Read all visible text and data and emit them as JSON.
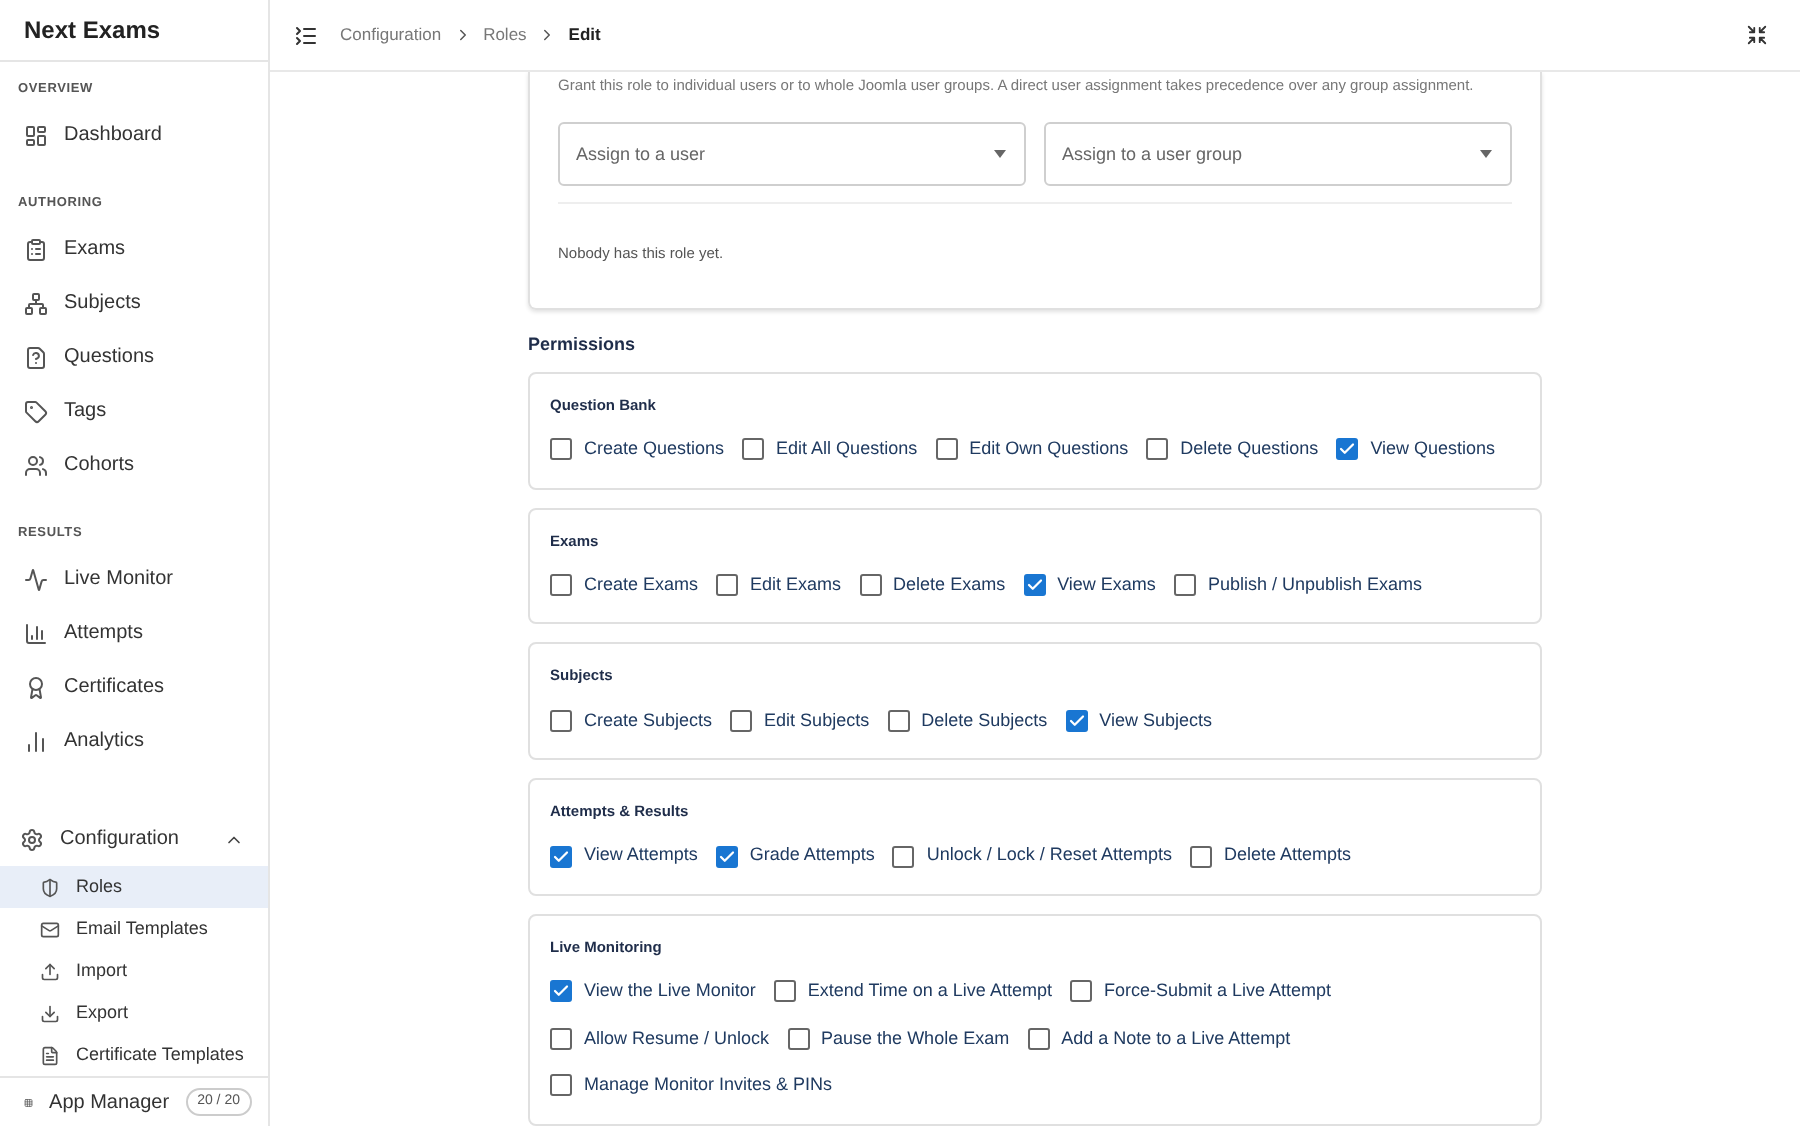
{
  "sidebar": {
    "title": "Next Exams",
    "sections": [
      {
        "heading": "OVERVIEW",
        "items": [
          {
            "label": "Dashboard",
            "selected": false
          }
        ]
      },
      {
        "heading": "AUTHORING",
        "items": [
          {
            "label": "Exams",
            "selected": false
          },
          {
            "label": "Subjects",
            "selected": false
          },
          {
            "label": "Questions",
            "selected": false
          },
          {
            "label": "Tags",
            "selected": false
          },
          {
            "label": "Cohorts",
            "selected": false
          }
        ]
      },
      {
        "heading": "RESULTS",
        "items": [
          {
            "label": "Live Monitor",
            "selected": false
          },
          {
            "label": "Attempts",
            "selected": false
          },
          {
            "label": "Certificates",
            "selected": false
          },
          {
            "label": "Analytics",
            "selected": false
          }
        ]
      },
      {
        "items": [
          {
            "label": "Configuration",
            "selected": false,
            "expanded": true,
            "children": [
              {
                "label": "Roles",
                "selected": true
              },
              {
                "label": "Email Templates",
                "selected": false
              },
              {
                "label": "Import",
                "selected": false
              },
              {
                "label": "Export",
                "selected": false
              },
              {
                "label": "Certificate Templates",
                "selected": false
              }
            ]
          }
        ]
      }
    ],
    "footer": {
      "label": "App Manager",
      "badge": "20 / 20"
    }
  },
  "breadcrumb": [
    "Configuration",
    "Roles",
    "Edit"
  ],
  "assignment": {
    "description": "Grant this role to individual users or to whole Joomla user groups. A direct user assignment takes precedence over any group assignment.",
    "fields": [
      {
        "placeholder": "Assign to a user"
      },
      {
        "placeholder": "Assign to a user group"
      }
    ],
    "empty_message": "Nobody has this role yet."
  },
  "permissions": {
    "heading": "Permissions",
    "groups": [
      {
        "title": "Question Bank",
        "items": [
          {
            "label": "Create Questions",
            "checked": false
          },
          {
            "label": "Edit All Questions",
            "checked": false
          },
          {
            "label": "Edit Own Questions",
            "checked": false
          },
          {
            "label": "Delete Questions",
            "checked": false
          },
          {
            "label": "View Questions",
            "checked": true
          }
        ]
      },
      {
        "title": "Exams",
        "items": [
          {
            "label": "Create Exams",
            "checked": false
          },
          {
            "label": "Edit Exams",
            "checked": false
          },
          {
            "label": "Delete Exams",
            "checked": false
          },
          {
            "label": "View Exams",
            "checked": true
          },
          {
            "label": "Publish / Unpublish Exams",
            "checked": false
          }
        ]
      },
      {
        "title": "Subjects",
        "items": [
          {
            "label": "Create Subjects",
            "checked": false
          },
          {
            "label": "Edit Subjects",
            "checked": false
          },
          {
            "label": "Delete Subjects",
            "checked": false
          },
          {
            "label": "View Subjects",
            "checked": true
          }
        ]
      },
      {
        "title": "Attempts & Results",
        "items": [
          {
            "label": "View Attempts",
            "checked": true
          },
          {
            "label": "Grade Attempts",
            "checked": true
          },
          {
            "label": "Unlock / Lock / Reset Attempts",
            "checked": false
          },
          {
            "label": "Delete Attempts",
            "checked": false
          }
        ]
      },
      {
        "title": "Live Monitoring",
        "items": [
          {
            "label": "View the Live Monitor",
            "checked": true
          },
          {
            "label": "Extend Time on a Live Attempt",
            "checked": false
          },
          {
            "label": "Force-Submit a Live Attempt",
            "checked": false
          },
          {
            "label": "Allow Resume / Unlock",
            "checked": false
          },
          {
            "label": "Pause the Whole Exam",
            "checked": false
          },
          {
            "label": "Add a Note to a Live Attempt",
            "checked": false
          },
          {
            "label": "Manage Monitor Invites & PINs",
            "checked": false
          }
        ]
      }
    ]
  }
}
